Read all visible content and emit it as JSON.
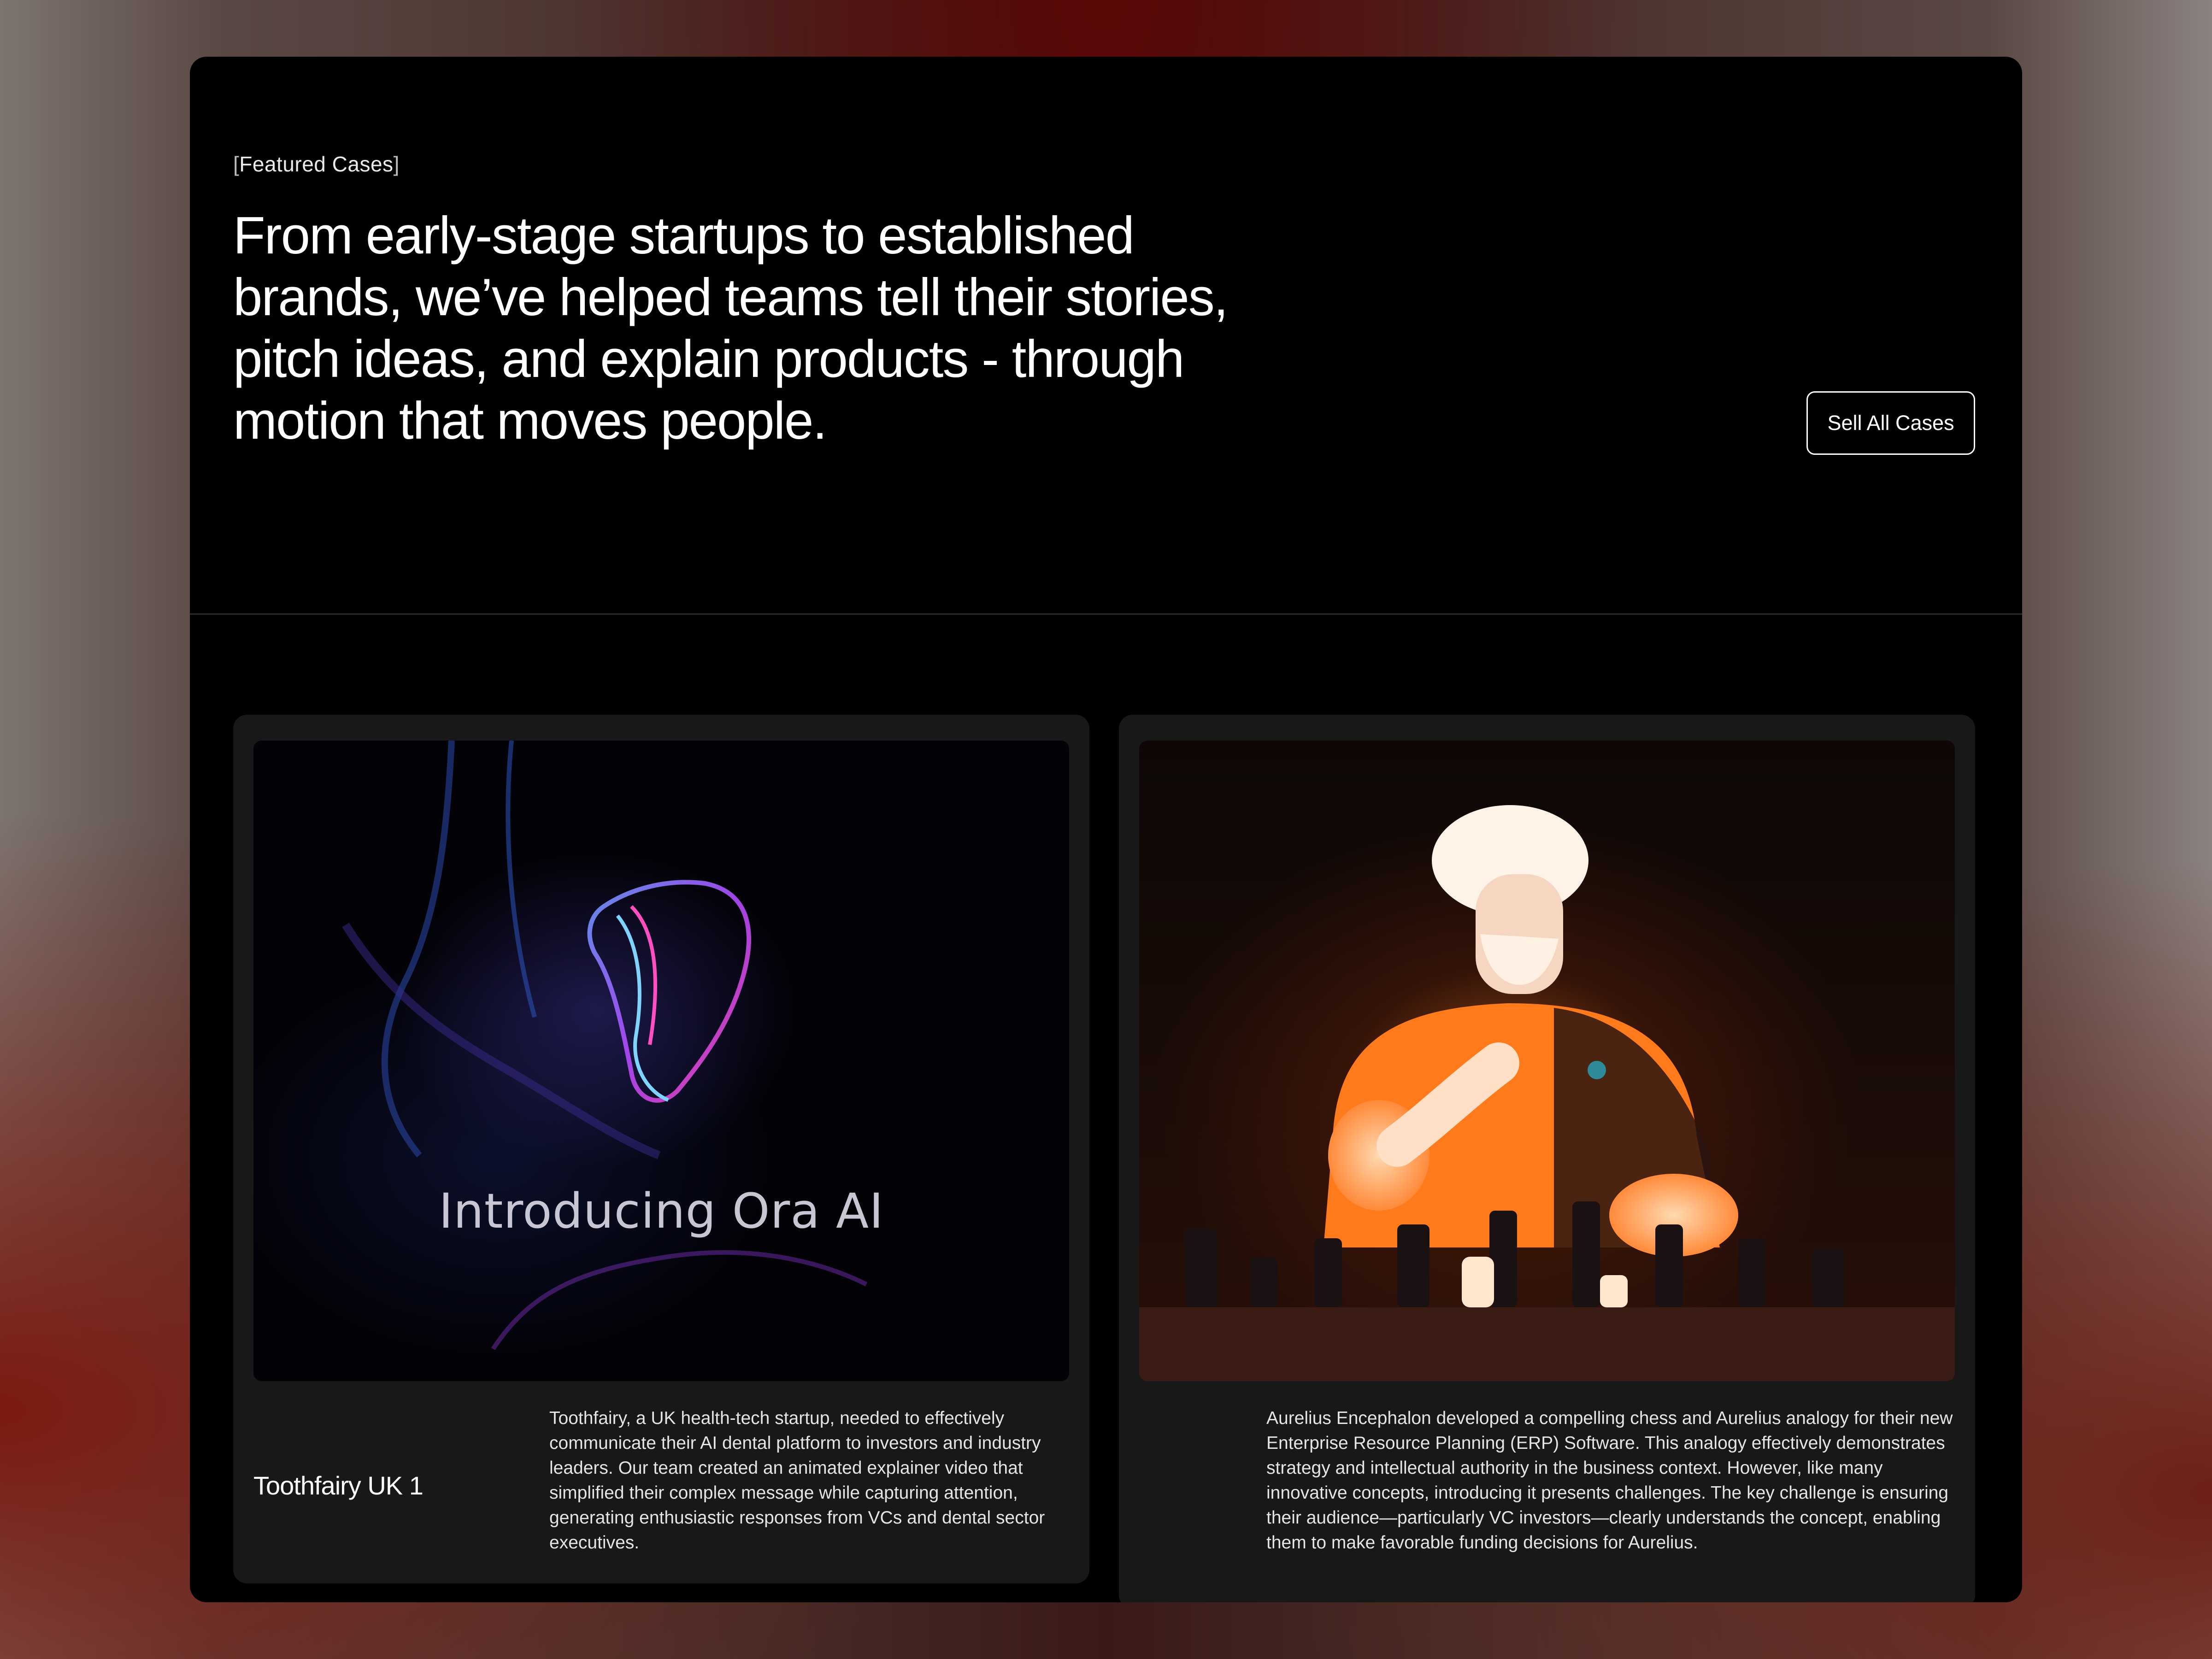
{
  "section": {
    "eyebrow": "Featured Cases",
    "eyebrow_open": "[",
    "eyebrow_close": "]",
    "headline": "From early-stage startups to established brands, we’ve helped teams tell their stories, pitch ideas, and explain products - through motion that moves people.",
    "cta_label": "Sell All Cases"
  },
  "cases": [
    {
      "title": "Toothfairy UK 1",
      "media_caption": "Introducing Ora AI",
      "description": "Toothfairy, a UK health-tech startup, needed to effectively communicate their AI dental platform to investors and industry leaders. Our team created an animated explainer video that simplified their complex message while capturing attention, generating enthusiastic responses from VCs and dental sector executives."
    },
    {
      "title": "",
      "description": "Aurelius Encephalon developed a compelling chess and Aurelius analogy for their new Enterprise Resource Planning (ERP) Software. This analogy effectively demonstrates strategy and intellectual authority in the business context. However, like many innovative concepts, introducing it presents challenges. The key challenge is ensuring their audience—particularly VC investors—clearly understands the concept, enabling them to make favorable funding decisions for Aurelius."
    }
  ],
  "colors": {
    "frame_bg": "#000000",
    "card_bg": "#181818",
    "accent_orange": "#ff7a1a"
  }
}
